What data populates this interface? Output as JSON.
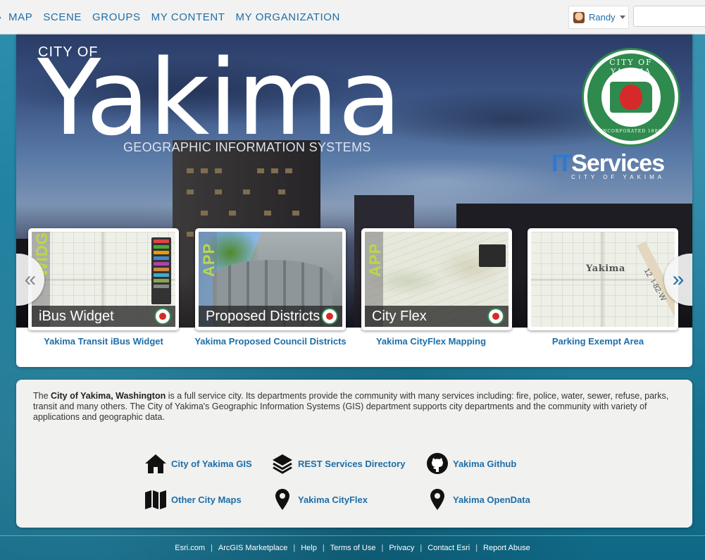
{
  "nav": {
    "items": [
      "MAP",
      "SCENE",
      "GROUPS",
      "MY CONTENT",
      "MY ORGANIZATION"
    ],
    "user": "Randy"
  },
  "banner": {
    "city_of": "CITY OF",
    "city_name": "Yakima",
    "subtitle": "GEOGRAPHIC INFORMATION SYSTEMS",
    "seal_top": "CITY OF YAKIMA",
    "seal_bottom": "INCORPORATED 1886",
    "it_prefix": "IT",
    "it_word": "Services",
    "it_sub": "CITY OF YAKIMA"
  },
  "cards": [
    {
      "tag": "WIDGET",
      "caption": "iBus Widget",
      "title": "Yakima Transit iBus Widget"
    },
    {
      "tag": "APP",
      "caption": "Proposed Districts",
      "title": "Yakima Proposed Council Districts"
    },
    {
      "tag": "APP",
      "caption": "City Flex",
      "title": "Yakima CityFlex Mapping"
    },
    {
      "tag": "",
      "caption": "",
      "map_label": "Yakima",
      "hwy_num": "12",
      "hwy_label": "I-82-W",
      "title": "Parking Exempt Area"
    }
  ],
  "info": {
    "lead": "The ",
    "bold": "City of Yakima, Washington",
    "rest": " is a full service city. Its departments provide the community with many services including: fire, police, water, sewer, refuse, parks, transit and many others. The City of Yakima's Geographic Information Systems (GIS) department supports city departments and the community with variety of applications and geographic data.",
    "links": [
      {
        "label": "City of Yakima GIS",
        "icon": "home-icon"
      },
      {
        "label": "REST Services Directory",
        "icon": "layers-icon"
      },
      {
        "label": "Yakima Github",
        "icon": "github-icon"
      },
      {
        "label": "Other City Maps",
        "icon": "map-icon"
      },
      {
        "label": "Yakima CityFlex",
        "icon": "map-pin-icon"
      },
      {
        "label": "Yakima OpenData",
        "icon": "map-pin-icon"
      }
    ]
  },
  "footer": {
    "links": [
      "Esri.com",
      "ArcGIS Marketplace",
      "Help",
      "Terms of Use",
      "Privacy",
      "Contact Esri",
      "Report Abuse"
    ],
    "separator": "|"
  },
  "colors": {
    "link_blue": "#1d6ea8",
    "seal_green": "#2f8a4d",
    "apple_red": "#d62a2a",
    "tag_green": "#b9d84a"
  }
}
